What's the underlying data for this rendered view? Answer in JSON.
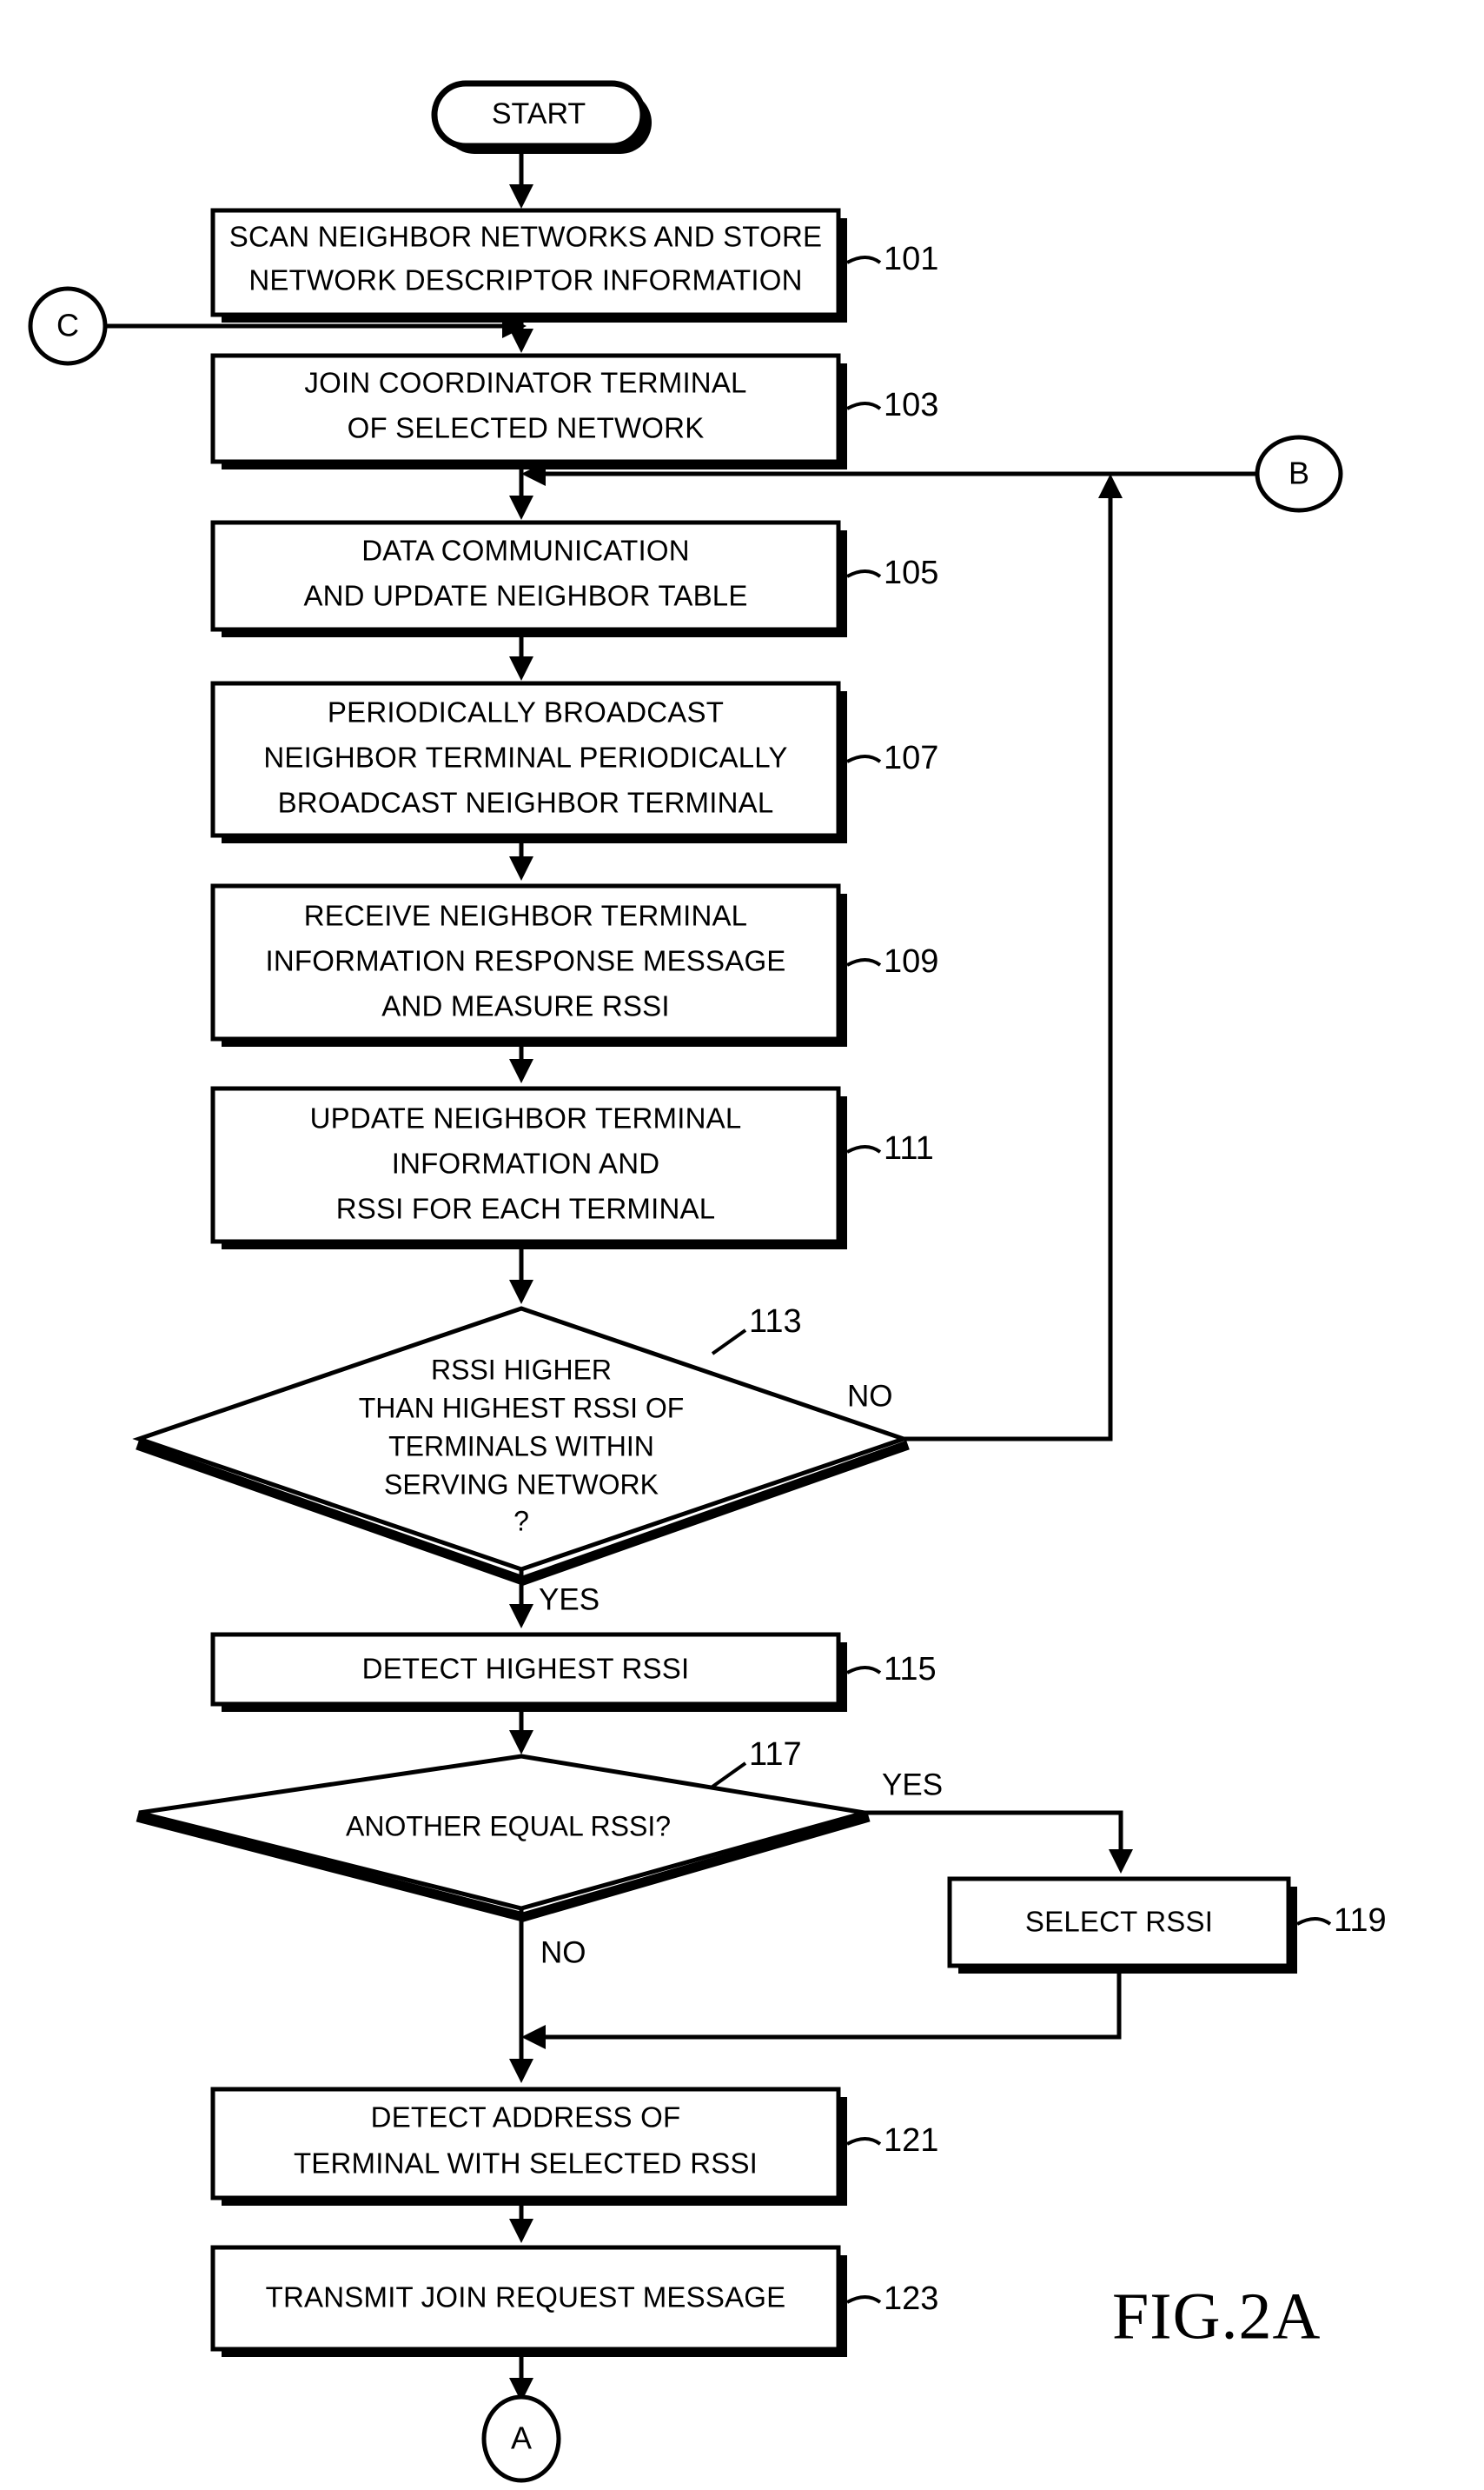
{
  "figure": {
    "label": "FIG.2A"
  },
  "terminators": {
    "start": "START",
    "end_connector": "A"
  },
  "connectors": {
    "c": "C",
    "b": "B",
    "a": "A"
  },
  "branch_labels": {
    "no_113": "NO",
    "yes_113": "YES",
    "yes_117": "YES",
    "no_117": "NO"
  },
  "nodes": [
    {
      "id": "101",
      "ref": "101",
      "type": "process",
      "lines": [
        "SCAN NEIGHBOR NETWORKS AND STORE",
        "NETWORK DESCRIPTOR INFORMATION"
      ]
    },
    {
      "id": "103",
      "ref": "103",
      "type": "process",
      "lines": [
        "JOIN COORDINATOR TERMINAL",
        "OF SELECTED NETWORK"
      ]
    },
    {
      "id": "105",
      "ref": "105",
      "type": "process",
      "lines": [
        "DATA COMMUNICATION",
        "AND UPDATE NEIGHBOR TABLE"
      ]
    },
    {
      "id": "107",
      "ref": "107",
      "type": "process",
      "lines": [
        "PERIODICALLY BROADCAST",
        "NEIGHBOR TERMINAL PERIODICALLY",
        "BROADCAST NEIGHBOR TERMINAL"
      ]
    },
    {
      "id": "109",
      "ref": "109",
      "type": "process",
      "lines": [
        "RECEIVE NEIGHBOR TERMINAL",
        "INFORMATION RESPONSE MESSAGE",
        "AND MEASURE RSSI"
      ]
    },
    {
      "id": "111",
      "ref": "111",
      "type": "process",
      "lines": [
        "UPDATE NEIGHBOR TERMINAL",
        "INFORMATION AND",
        "RSSI FOR EACH TERMINAL"
      ]
    },
    {
      "id": "113",
      "ref": "113",
      "type": "decision",
      "lines": [
        "RSSI HIGHER",
        "THAN HIGHEST RSSI OF",
        "TERMINALS WITHIN",
        "SERVING NETWORK",
        "?"
      ]
    },
    {
      "id": "115",
      "ref": "115",
      "type": "process",
      "lines": [
        "DETECT HIGHEST RSSI"
      ]
    },
    {
      "id": "117",
      "ref": "117",
      "type": "decision",
      "lines": [
        "ANOTHER EQUAL RSSI?"
      ]
    },
    {
      "id": "119",
      "ref": "119",
      "type": "process",
      "lines": [
        "SELECT RSSI"
      ]
    },
    {
      "id": "121",
      "ref": "121",
      "type": "process",
      "lines": [
        "DETECT ADDRESS OF",
        "TERMINAL WITH SELECTED RSSI"
      ]
    },
    {
      "id": "123",
      "ref": "123",
      "type": "process",
      "lines": [
        "TRANSMIT JOIN REQUEST MESSAGE"
      ]
    }
  ],
  "text": {
    "n101_l1": "SCAN NEIGHBOR NETWORKS AND STORE",
    "n101_l2": "NETWORK DESCRIPTOR INFORMATION",
    "n101_ref": "101",
    "n103_l1": "JOIN COORDINATOR TERMINAL",
    "n103_l2": "OF SELECTED NETWORK",
    "n103_ref": "103",
    "n105_l1": "DATA COMMUNICATION",
    "n105_l2": "AND UPDATE NEIGHBOR TABLE",
    "n105_ref": "105",
    "n107_l1": "PERIODICALLY BROADCAST",
    "n107_l2": "NEIGHBOR TERMINAL PERIODICALLY",
    "n107_l3": "BROADCAST NEIGHBOR TERMINAL",
    "n107_ref": "107",
    "n109_l1": "RECEIVE NEIGHBOR TERMINAL",
    "n109_l2": "INFORMATION RESPONSE MESSAGE",
    "n109_l3": "AND MEASURE RSSI",
    "n109_ref": "109",
    "n111_l1": "UPDATE NEIGHBOR TERMINAL",
    "n111_l2": "INFORMATION AND",
    "n111_l3": "RSSI FOR EACH TERMINAL",
    "n111_ref": "111",
    "n113_l1": "RSSI HIGHER",
    "n113_l2": "THAN HIGHEST RSSI OF",
    "n113_l3": "TERMINALS WITHIN",
    "n113_l4": "SERVING NETWORK",
    "n113_l5": "?",
    "n113_ref": "113",
    "n115_l1": "DETECT HIGHEST RSSI",
    "n115_ref": "115",
    "n117_l1": "ANOTHER EQUAL RSSI?",
    "n117_ref": "117",
    "n119_l1": "SELECT RSSI",
    "n119_ref": "119",
    "n121_l1": "DETECT ADDRESS OF",
    "n121_l2": "TERMINAL WITH SELECTED RSSI",
    "n121_ref": "121",
    "n123_l1": "TRANSMIT JOIN REQUEST MESSAGE",
    "n123_ref": "123",
    "start": "START",
    "conn_c": "C",
    "conn_b": "B",
    "conn_a": "A",
    "no_113": "NO",
    "yes_113": "YES",
    "yes_117": "YES",
    "no_117": "NO",
    "fig": "FIG.2A"
  },
  "colors": {
    "ink": "#000000",
    "paper": "#ffffff"
  }
}
